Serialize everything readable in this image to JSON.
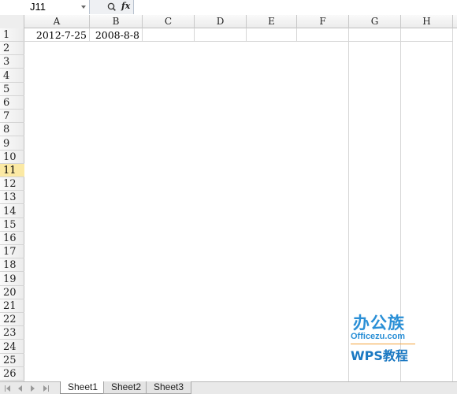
{
  "name_box": {
    "value": "J11"
  },
  "formula_bar": {
    "fx_label": "fx",
    "formula": ""
  },
  "columns": [
    "A",
    "B",
    "C",
    "D",
    "E",
    "F",
    "G",
    "H"
  ],
  "rows": [
    "1",
    "2",
    "3",
    "4",
    "5",
    "6",
    "7",
    "8",
    "9",
    "10",
    "11",
    "12",
    "13",
    "14",
    "15",
    "16",
    "17",
    "18",
    "19",
    "20",
    "21",
    "22",
    "23",
    "24",
    "25",
    "26"
  ],
  "active_row": "11",
  "cells": {
    "A1": "2012-7-25",
    "B1": "2008-8-8"
  },
  "sheet_tabs": [
    {
      "label": "Sheet1",
      "active": true
    },
    {
      "label": "Sheet2",
      "active": false
    },
    {
      "label": "Sheet3",
      "active": false
    }
  ],
  "watermark": {
    "brand": "办公族",
    "domain": "Officezu.com",
    "subtitle": "WPS教程"
  },
  "colors": {
    "active_row_highlight": "#fbe9a4",
    "watermark_blue": "#2a8fd6",
    "grid_line": "#d6d6d6"
  }
}
